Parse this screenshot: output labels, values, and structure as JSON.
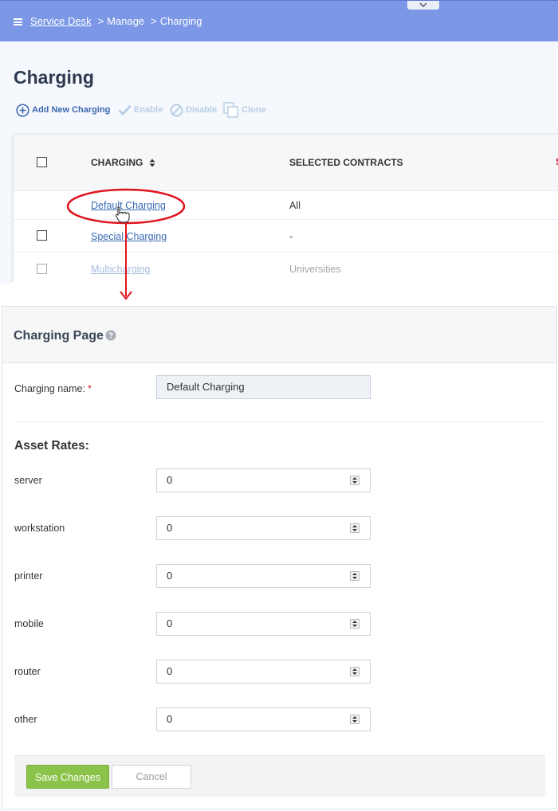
{
  "breadcrumb": {
    "root": "Service Desk",
    "items": [
      "Manage",
      "Charging"
    ],
    "separator": ">"
  },
  "page_title": "Charging",
  "toolbar": {
    "add": "Add New Charging",
    "enable": "Enable",
    "disable": "Disable",
    "clone": "Clone"
  },
  "table": {
    "columns": [
      "CHARGING",
      "SELECTED CONTRACTS"
    ],
    "rows": [
      {
        "name": "Default Charging",
        "contracts": "All",
        "has_checkbox": false
      },
      {
        "name": "Special Charging",
        "contracts": "-",
        "has_checkbox": true
      },
      {
        "name": "Multicharging",
        "contracts": "Universities",
        "has_checkbox": true
      }
    ]
  },
  "form": {
    "title": "Charging Page",
    "name_label": "Charging name:",
    "required_mark": "*",
    "name_value": "Default Charging",
    "section_title": "Asset Rates:",
    "rates": [
      {
        "label": "server",
        "value": "0"
      },
      {
        "label": "workstation",
        "value": "0"
      },
      {
        "label": "printer",
        "value": "0"
      },
      {
        "label": "mobile",
        "value": "0"
      },
      {
        "label": "router",
        "value": "0"
      },
      {
        "label": "other",
        "value": "0"
      }
    ],
    "save_label": "Save Changes",
    "cancel_label": "Cancel"
  },
  "colors": {
    "header_bar": "#7b97e6",
    "link": "#3a6ab6",
    "save_button": "#8bc34a",
    "annotation": "#e0141e"
  }
}
